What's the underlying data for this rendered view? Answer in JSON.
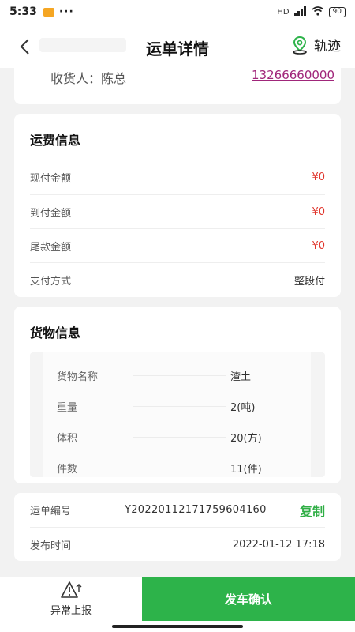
{
  "status_bar": {
    "time": "5:33",
    "dots": "···",
    "network": "HD",
    "battery": "90"
  },
  "nav": {
    "title": "运单详情",
    "track_label": "轨迹"
  },
  "receiver": {
    "label": "收货人：陈总",
    "phone": "13266660000"
  },
  "freight": {
    "title": "运费信息",
    "rows": [
      {
        "key": "现付金额",
        "value": "¥0"
      },
      {
        "key": "到付金额",
        "value": "¥0"
      },
      {
        "key": "尾款金额",
        "value": "¥0"
      },
      {
        "key": "支付方式",
        "value": "整段付"
      }
    ]
  },
  "goods": {
    "title": "货物信息",
    "rows": [
      {
        "key": "货物名称",
        "value": "渣土"
      },
      {
        "key": "重量",
        "value": "2(吨)"
      },
      {
        "key": "体积",
        "value": "20(方)"
      },
      {
        "key": "件数",
        "value": "11(件)"
      }
    ]
  },
  "order": {
    "number_label": "运单编号",
    "number_value": "Y20220112171759604160",
    "copy_label": "复制",
    "time_label": "发布时间",
    "time_value": "2022-01-12 17:18"
  },
  "bottom": {
    "report_label": "异常上报",
    "confirm_label": "发车确认"
  },
  "colors": {
    "accent": "#2db34a",
    "price": "#e0342b",
    "phone_link": "#a0267a"
  }
}
